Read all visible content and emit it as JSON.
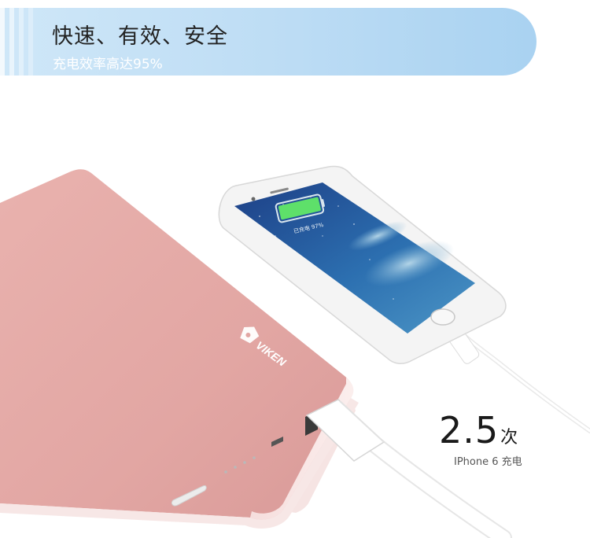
{
  "banner": {
    "title": "快速、有效、安全",
    "subtitle": "充电效率高达95%"
  },
  "phone": {
    "screen_text": "已充电 97%",
    "battery_fill": 0.97
  },
  "power_bank": {
    "brand": "VIKEN"
  },
  "stat": {
    "value": "2.5",
    "unit": "次",
    "caption": "IPhone 6 充电"
  },
  "colors": {
    "banner": "#bcdcf4",
    "power_bank": "#e8aeae",
    "battery_green": "#5ee06a"
  }
}
